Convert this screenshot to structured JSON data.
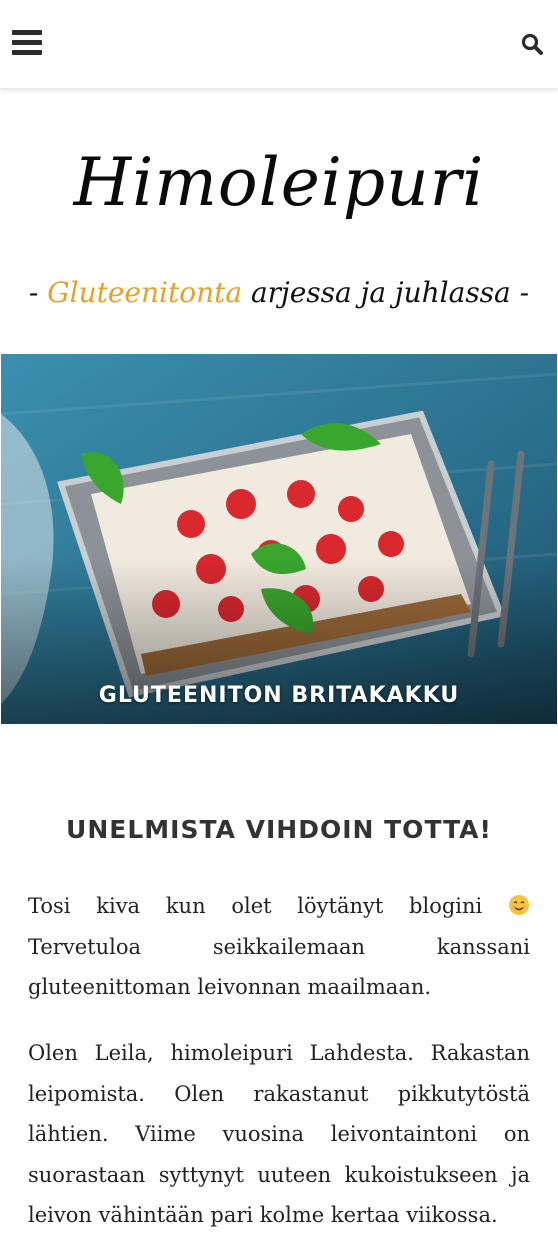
{
  "header": {
    "menu_icon": "hamburger-menu-icon",
    "search_icon": "search-icon"
  },
  "site": {
    "title": "Himoleipuri",
    "tagline_prefix": "- ",
    "tagline_accent": "Gluteenitonta",
    "tagline_rest": " arjessa ja juhlassa -",
    "accent_color": "#e5a22a"
  },
  "hero": {
    "title": "GLUTEENITON BRITAKAKKU",
    "image": "photo-strawberry-meringue-cake-on-silver-tray"
  },
  "intro": {
    "heading": "UNELMISTA VIHDOIN TOTTA!",
    "p1_before": "Tosi kiva kun olet löytänyt blogini ",
    "p1_emoji": "smiling-face-emoji",
    "p1_after": " Tervetuloa seikkailemaan kanssani gluteenittoman leivonnan maailmaan.",
    "p2": "Olen Leila, himoleipuri Lahdesta. Rakastan leipomista. Olen rakastanut pikkutytöstä lähtien. Viime vuosina leivontaintoni on suorastaan syttynyt uuteen kukoistukseen ja leivon vähintään pari kolme kertaa viikossa."
  }
}
